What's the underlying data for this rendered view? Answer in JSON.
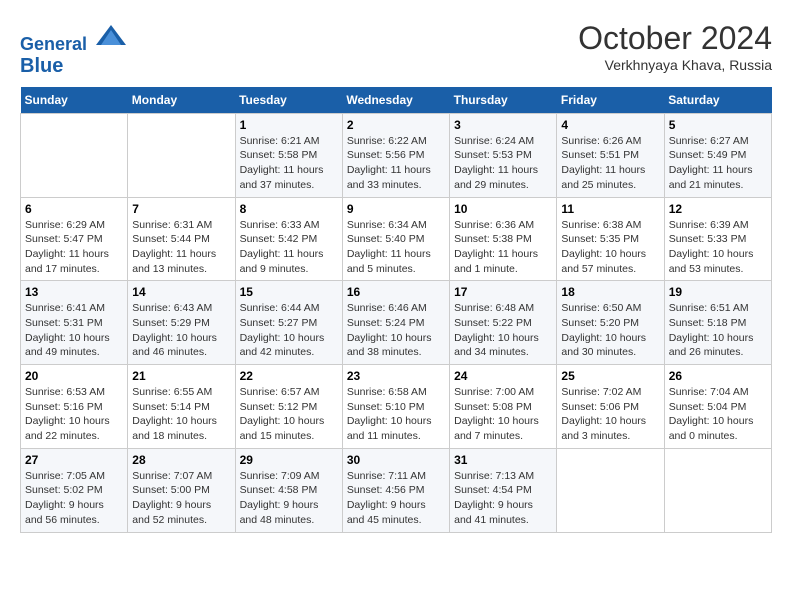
{
  "header": {
    "logo_line1": "General",
    "logo_line2": "Blue",
    "month": "October 2024",
    "location": "Verkhnyaya Khava, Russia"
  },
  "weekdays": [
    "Sunday",
    "Monday",
    "Tuesday",
    "Wednesday",
    "Thursday",
    "Friday",
    "Saturday"
  ],
  "weeks": [
    [
      {
        "day": "",
        "info": ""
      },
      {
        "day": "",
        "info": ""
      },
      {
        "day": "1",
        "info": "Sunrise: 6:21 AM\nSunset: 5:58 PM\nDaylight: 11 hours and 37 minutes."
      },
      {
        "day": "2",
        "info": "Sunrise: 6:22 AM\nSunset: 5:56 PM\nDaylight: 11 hours and 33 minutes."
      },
      {
        "day": "3",
        "info": "Sunrise: 6:24 AM\nSunset: 5:53 PM\nDaylight: 11 hours and 29 minutes."
      },
      {
        "day": "4",
        "info": "Sunrise: 6:26 AM\nSunset: 5:51 PM\nDaylight: 11 hours and 25 minutes."
      },
      {
        "day": "5",
        "info": "Sunrise: 6:27 AM\nSunset: 5:49 PM\nDaylight: 11 hours and 21 minutes."
      }
    ],
    [
      {
        "day": "6",
        "info": "Sunrise: 6:29 AM\nSunset: 5:47 PM\nDaylight: 11 hours and 17 minutes."
      },
      {
        "day": "7",
        "info": "Sunrise: 6:31 AM\nSunset: 5:44 PM\nDaylight: 11 hours and 13 minutes."
      },
      {
        "day": "8",
        "info": "Sunrise: 6:33 AM\nSunset: 5:42 PM\nDaylight: 11 hours and 9 minutes."
      },
      {
        "day": "9",
        "info": "Sunrise: 6:34 AM\nSunset: 5:40 PM\nDaylight: 11 hours and 5 minutes."
      },
      {
        "day": "10",
        "info": "Sunrise: 6:36 AM\nSunset: 5:38 PM\nDaylight: 11 hours and 1 minute."
      },
      {
        "day": "11",
        "info": "Sunrise: 6:38 AM\nSunset: 5:35 PM\nDaylight: 10 hours and 57 minutes."
      },
      {
        "day": "12",
        "info": "Sunrise: 6:39 AM\nSunset: 5:33 PM\nDaylight: 10 hours and 53 minutes."
      }
    ],
    [
      {
        "day": "13",
        "info": "Sunrise: 6:41 AM\nSunset: 5:31 PM\nDaylight: 10 hours and 49 minutes."
      },
      {
        "day": "14",
        "info": "Sunrise: 6:43 AM\nSunset: 5:29 PM\nDaylight: 10 hours and 46 minutes."
      },
      {
        "day": "15",
        "info": "Sunrise: 6:44 AM\nSunset: 5:27 PM\nDaylight: 10 hours and 42 minutes."
      },
      {
        "day": "16",
        "info": "Sunrise: 6:46 AM\nSunset: 5:24 PM\nDaylight: 10 hours and 38 minutes."
      },
      {
        "day": "17",
        "info": "Sunrise: 6:48 AM\nSunset: 5:22 PM\nDaylight: 10 hours and 34 minutes."
      },
      {
        "day": "18",
        "info": "Sunrise: 6:50 AM\nSunset: 5:20 PM\nDaylight: 10 hours and 30 minutes."
      },
      {
        "day": "19",
        "info": "Sunrise: 6:51 AM\nSunset: 5:18 PM\nDaylight: 10 hours and 26 minutes."
      }
    ],
    [
      {
        "day": "20",
        "info": "Sunrise: 6:53 AM\nSunset: 5:16 PM\nDaylight: 10 hours and 22 minutes."
      },
      {
        "day": "21",
        "info": "Sunrise: 6:55 AM\nSunset: 5:14 PM\nDaylight: 10 hours and 18 minutes."
      },
      {
        "day": "22",
        "info": "Sunrise: 6:57 AM\nSunset: 5:12 PM\nDaylight: 10 hours and 15 minutes."
      },
      {
        "day": "23",
        "info": "Sunrise: 6:58 AM\nSunset: 5:10 PM\nDaylight: 10 hours and 11 minutes."
      },
      {
        "day": "24",
        "info": "Sunrise: 7:00 AM\nSunset: 5:08 PM\nDaylight: 10 hours and 7 minutes."
      },
      {
        "day": "25",
        "info": "Sunrise: 7:02 AM\nSunset: 5:06 PM\nDaylight: 10 hours and 3 minutes."
      },
      {
        "day": "26",
        "info": "Sunrise: 7:04 AM\nSunset: 5:04 PM\nDaylight: 10 hours and 0 minutes."
      }
    ],
    [
      {
        "day": "27",
        "info": "Sunrise: 7:05 AM\nSunset: 5:02 PM\nDaylight: 9 hours and 56 minutes."
      },
      {
        "day": "28",
        "info": "Sunrise: 7:07 AM\nSunset: 5:00 PM\nDaylight: 9 hours and 52 minutes."
      },
      {
        "day": "29",
        "info": "Sunrise: 7:09 AM\nSunset: 4:58 PM\nDaylight: 9 hours and 48 minutes."
      },
      {
        "day": "30",
        "info": "Sunrise: 7:11 AM\nSunset: 4:56 PM\nDaylight: 9 hours and 45 minutes."
      },
      {
        "day": "31",
        "info": "Sunrise: 7:13 AM\nSunset: 4:54 PM\nDaylight: 9 hours and 41 minutes."
      },
      {
        "day": "",
        "info": ""
      },
      {
        "day": "",
        "info": ""
      }
    ]
  ]
}
